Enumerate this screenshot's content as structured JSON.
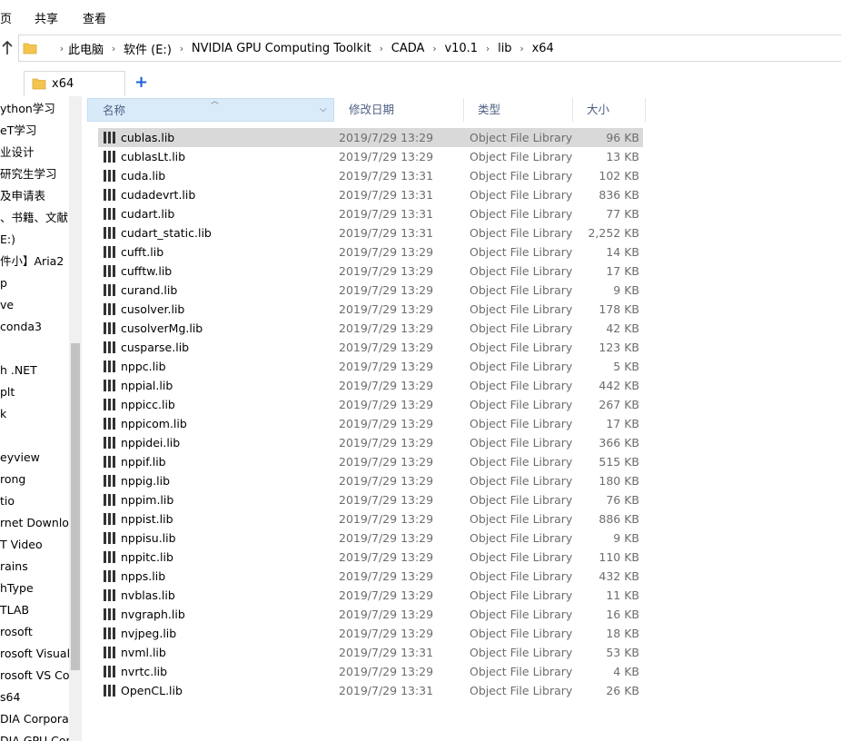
{
  "ribbon": {
    "tabs": [
      "页",
      "共享",
      "查看"
    ]
  },
  "address": {
    "crumbs": [
      "此电脑",
      "软件 (E:)",
      "NVIDIA GPU Computing Toolkit",
      "CADA",
      "v10.1",
      "lib",
      "x64"
    ]
  },
  "tab": {
    "label": "x64",
    "add": "+"
  },
  "nav": {
    "items": [
      "ython学习",
      "eT学习",
      "业设计",
      "研究生学习",
      "及申请表",
      "、书籍、文献",
      "E:)",
      "件小】Aria2",
      "p",
      "ve",
      "conda3",
      "",
      "h .NET",
      "plt",
      "k",
      "",
      "eyview",
      "rong",
      "tio",
      "rnet Downloa",
      "T Video",
      "rains",
      "hType",
      "TLAB",
      "rosoft",
      "rosoft Visual",
      "rosoft VS Coc",
      "s64",
      "DIA Corporat",
      "DIA GPU Com"
    ]
  },
  "columns": {
    "name": "名称",
    "date": "修改日期",
    "type": "类型",
    "size": "大小"
  },
  "files": [
    {
      "name": "cublas.lib",
      "date": "2019/7/29 13:29",
      "type": "Object File Library",
      "size": "96 KB"
    },
    {
      "name": "cublasLt.lib",
      "date": "2019/7/29 13:29",
      "type": "Object File Library",
      "size": "13 KB"
    },
    {
      "name": "cuda.lib",
      "date": "2019/7/29 13:31",
      "type": "Object File Library",
      "size": "102 KB"
    },
    {
      "name": "cudadevrt.lib",
      "date": "2019/7/29 13:31",
      "type": "Object File Library",
      "size": "836 KB"
    },
    {
      "name": "cudart.lib",
      "date": "2019/7/29 13:31",
      "type": "Object File Library",
      "size": "77 KB"
    },
    {
      "name": "cudart_static.lib",
      "date": "2019/7/29 13:31",
      "type": "Object File Library",
      "size": "2,252 KB"
    },
    {
      "name": "cufft.lib",
      "date": "2019/7/29 13:29",
      "type": "Object File Library",
      "size": "14 KB"
    },
    {
      "name": "cufftw.lib",
      "date": "2019/7/29 13:29",
      "type": "Object File Library",
      "size": "17 KB"
    },
    {
      "name": "curand.lib",
      "date": "2019/7/29 13:29",
      "type": "Object File Library",
      "size": "9 KB"
    },
    {
      "name": "cusolver.lib",
      "date": "2019/7/29 13:29",
      "type": "Object File Library",
      "size": "178 KB"
    },
    {
      "name": "cusolverMg.lib",
      "date": "2019/7/29 13:29",
      "type": "Object File Library",
      "size": "42 KB"
    },
    {
      "name": "cusparse.lib",
      "date": "2019/7/29 13:29",
      "type": "Object File Library",
      "size": "123 KB"
    },
    {
      "name": "nppc.lib",
      "date": "2019/7/29 13:29",
      "type": "Object File Library",
      "size": "5 KB"
    },
    {
      "name": "nppial.lib",
      "date": "2019/7/29 13:29",
      "type": "Object File Library",
      "size": "442 KB"
    },
    {
      "name": "nppicc.lib",
      "date": "2019/7/29 13:29",
      "type": "Object File Library",
      "size": "267 KB"
    },
    {
      "name": "nppicom.lib",
      "date": "2019/7/29 13:29",
      "type": "Object File Library",
      "size": "17 KB"
    },
    {
      "name": "nppidei.lib",
      "date": "2019/7/29 13:29",
      "type": "Object File Library",
      "size": "366 KB"
    },
    {
      "name": "nppif.lib",
      "date": "2019/7/29 13:29",
      "type": "Object File Library",
      "size": "515 KB"
    },
    {
      "name": "nppig.lib",
      "date": "2019/7/29 13:29",
      "type": "Object File Library",
      "size": "180 KB"
    },
    {
      "name": "nppim.lib",
      "date": "2019/7/29 13:29",
      "type": "Object File Library",
      "size": "76 KB"
    },
    {
      "name": "nppist.lib",
      "date": "2019/7/29 13:29",
      "type": "Object File Library",
      "size": "886 KB"
    },
    {
      "name": "nppisu.lib",
      "date": "2019/7/29 13:29",
      "type": "Object File Library",
      "size": "9 KB"
    },
    {
      "name": "nppitc.lib",
      "date": "2019/7/29 13:29",
      "type": "Object File Library",
      "size": "110 KB"
    },
    {
      "name": "npps.lib",
      "date": "2019/7/29 13:29",
      "type": "Object File Library",
      "size": "432 KB"
    },
    {
      "name": "nvblas.lib",
      "date": "2019/7/29 13:29",
      "type": "Object File Library",
      "size": "11 KB"
    },
    {
      "name": "nvgraph.lib",
      "date": "2019/7/29 13:29",
      "type": "Object File Library",
      "size": "16 KB"
    },
    {
      "name": "nvjpeg.lib",
      "date": "2019/7/29 13:29",
      "type": "Object File Library",
      "size": "18 KB"
    },
    {
      "name": "nvml.lib",
      "date": "2019/7/29 13:31",
      "type": "Object File Library",
      "size": "53 KB"
    },
    {
      "name": "nvrtc.lib",
      "date": "2019/7/29 13:29",
      "type": "Object File Library",
      "size": "4 KB"
    },
    {
      "name": "OpenCL.lib",
      "date": "2019/7/29 13:31",
      "type": "Object File Library",
      "size": "26 KB"
    }
  ],
  "selected_index": 0,
  "colors": {
    "folder": "#f3c54e",
    "selection": "#d9d9d9",
    "header_active": "#d9ebf9",
    "accent": "#1a63d6"
  },
  "icons": {
    "up": "up-arrow-icon",
    "folder": "folder-icon",
    "file": "library-file-icon",
    "sort": "sort-ascending-icon"
  }
}
